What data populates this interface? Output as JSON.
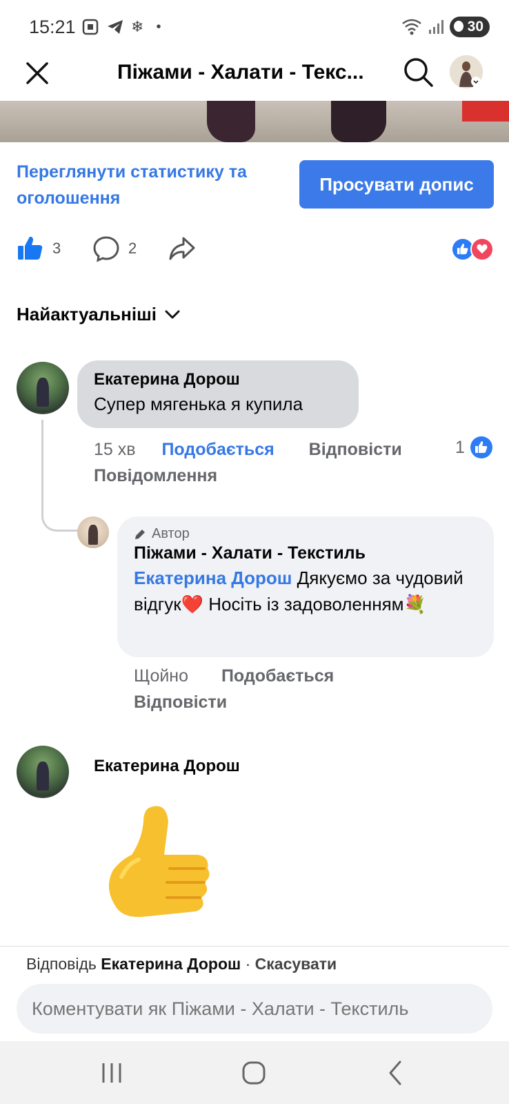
{
  "status_bar": {
    "time": "15:21",
    "battery": "30"
  },
  "header": {
    "title": "Піжами - Халати - Текс..."
  },
  "post_actions": {
    "stats_link": "Переглянути статистику та оголошення",
    "promote_button": "Просувати допис",
    "like_count": "3",
    "comment_count": "2"
  },
  "sort": {
    "label": "Найактуальніші"
  },
  "comments": [
    {
      "author": "Екатерина Дорош",
      "text": "Супер мягенька я купила",
      "time": "15 хв",
      "like_label": "Подобається",
      "reply_label": "Відповісти",
      "like_count": "1",
      "message_label": "Повідомлення"
    },
    {
      "badge": "Автор",
      "author": "Піжами - Халати - Текстиль",
      "mention": "Екатерина Дорош",
      "text": "Дякуємо за чудовий відгук❤️ Носіть із задоволенням💐",
      "time": "Щойно",
      "like_label": "Подобається",
      "reply_label": "Відповісти"
    },
    {
      "author": "Екатерина Дорош",
      "sticker": "thumbs-up"
    }
  ],
  "composer": {
    "replying_prefix": "Відповідь",
    "replying_name": "Екатерина Дорош",
    "separator": " · ",
    "cancel_label": "Скасувати",
    "placeholder": "Коментувати як Піжами - Халати - Текстиль"
  },
  "colors": {
    "accent": "#3578e5",
    "promote_bg": "#3b7ae8",
    "bubble": "#e4e6eb",
    "love": "#f0475c"
  }
}
